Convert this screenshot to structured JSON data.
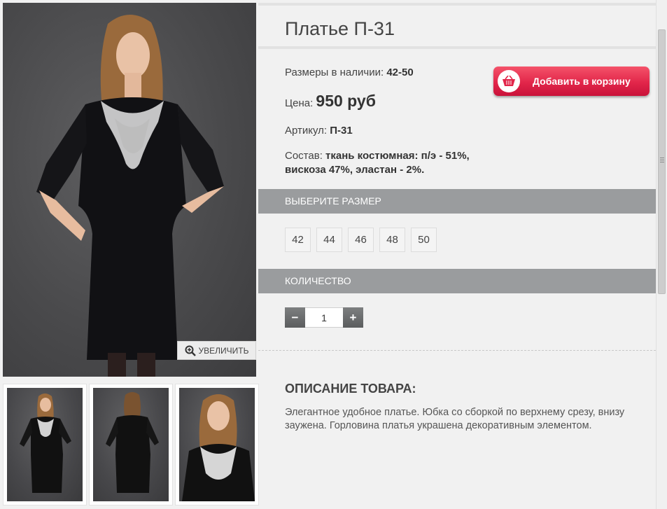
{
  "product": {
    "title": "Платье П-31",
    "sizes_label": "Размеры в наличии:",
    "sizes_value": "42-50",
    "price_label": "Цена:",
    "price_value": "950 руб",
    "article_label": "Артикул:",
    "article_value": "П-31",
    "composition_label": "Состав:",
    "composition_value": "ткань костюмная: п/э - 51%, вискоза 47%, эластан - 2%."
  },
  "cart_button": {
    "label": "Добавить в корзину",
    "icon": "basket-icon",
    "color": "#e2264a"
  },
  "zoom_button": {
    "label": "УВЕЛИЧИТЬ",
    "icon": "magnify-plus-icon"
  },
  "size_section": {
    "title": "ВЫБЕРИТЕ РАЗМЕР",
    "options": [
      "42",
      "44",
      "46",
      "48",
      "50"
    ]
  },
  "quantity_section": {
    "title": "КОЛИЧЕСТВО",
    "minus": "−",
    "plus": "+",
    "value": "1"
  },
  "description": {
    "title": "ОПИСАНИЕ ТОВАРА:",
    "text": "Элегантное удобное платье. Юбка со сборкой по верхнему срезу, внизу заужена. Горловина платья украшена декоративным элементом."
  },
  "colors": {
    "section_bar": "#9a9c9e",
    "background": "#f1f1f1"
  }
}
